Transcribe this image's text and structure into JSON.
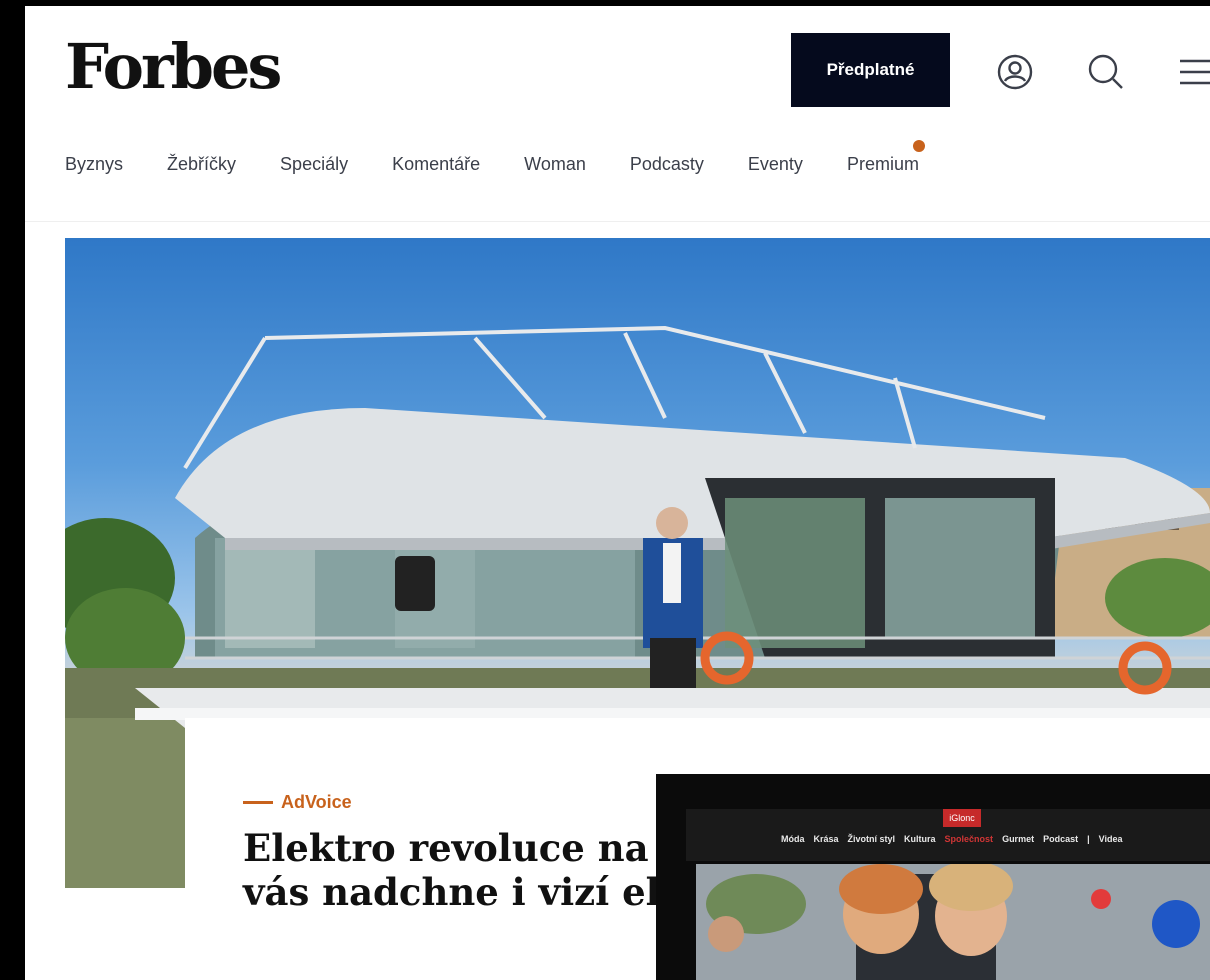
{
  "brand": {
    "logo_text": "Forbes"
  },
  "header": {
    "subscribe_label": "Předplatné",
    "icons": [
      "account-icon",
      "search-icon",
      "menu-icon"
    ]
  },
  "nav": {
    "items": [
      {
        "label": "Byznys"
      },
      {
        "label": "Žebříčky"
      },
      {
        "label": "Speciály"
      },
      {
        "label": "Komentáře"
      },
      {
        "label": "Woman"
      },
      {
        "label": "Podcasty"
      },
      {
        "label": "Eventy"
      },
      {
        "label": "Premium",
        "has_dot": true
      }
    ]
  },
  "article": {
    "category": "AdVoice",
    "headline_line1": "Elektro revoluce na V",
    "headline_line2": "vás nadchne i vizí ek"
  },
  "overlay": {
    "logo": "iGlonc",
    "nav": [
      "Móda",
      "Krása",
      "Životní styl",
      "Kultura",
      "Společnost",
      "Gurmet",
      "Podcast",
      "|",
      "Videa"
    ],
    "active_item": "Společnost"
  },
  "colors": {
    "accent": "#c8621c",
    "button_bg": "#050a1d",
    "overlay_accent": "#c62a2a"
  }
}
